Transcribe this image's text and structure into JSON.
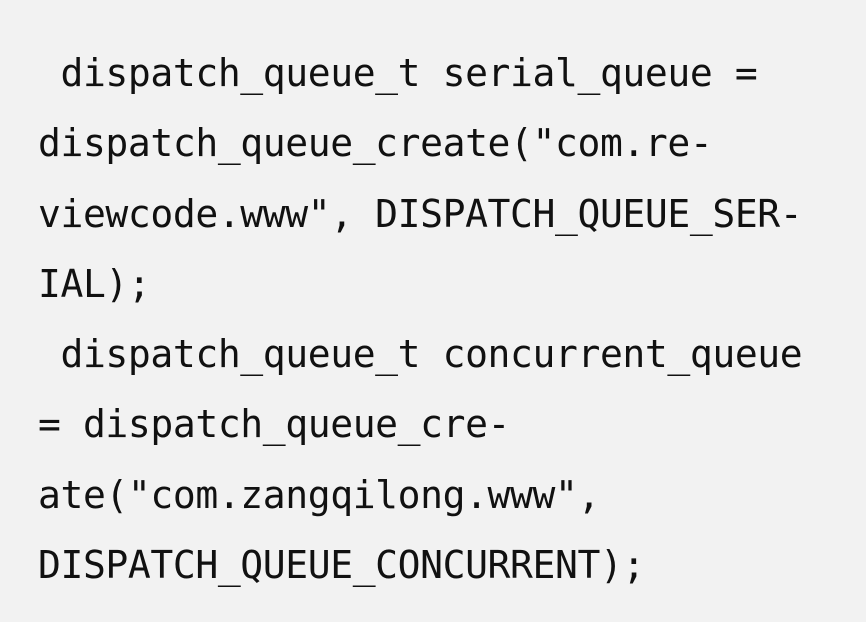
{
  "code": {
    "lines": [
      " dispatch_queue_t serial_queue =",
      "dispatch_queue_create(\"com.re-",
      "viewcode.www\", DISPATCH_QUEUE_SER-",
      "IAL);",
      " dispatch_queue_t concurrent_queue",
      "= dispatch_queue_cre-",
      "ate(\"com.zangqilong.www\",",
      "DISPATCH_QUEUE_CONCURRENT);"
    ]
  }
}
